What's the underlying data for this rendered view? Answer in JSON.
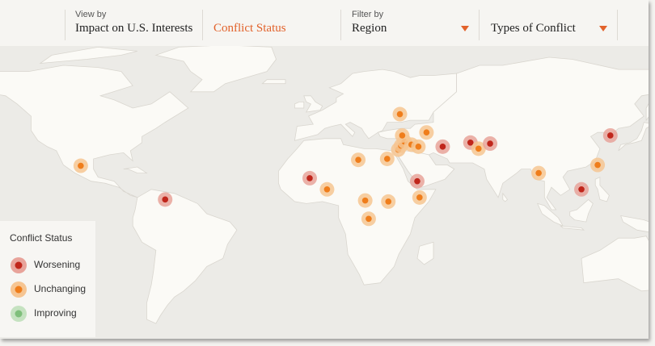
{
  "toolbar": {
    "view_by_label": "View by",
    "view_options": [
      "Impact on U.S. Interests",
      "Conflict Status"
    ],
    "active_view": "Conflict Status",
    "filter_by_label": "Filter by",
    "filters": [
      "Region",
      "Types of Conflict"
    ]
  },
  "legend": {
    "title": "Conflict Status",
    "items": [
      {
        "label": "Worsening",
        "color": "#c0261b",
        "halo": "#e8a39a"
      },
      {
        "label": "Unchanging",
        "color": "#ef7d1b",
        "halo": "#f6c592"
      },
      {
        "label": "Improving",
        "color": "#7fbf7b",
        "halo": "#c5e2c0"
      }
    ]
  },
  "colors": {
    "land": "#fbfaf6",
    "ocean": "#ecebe7",
    "border": "#d9d6cf",
    "accent": "#e2622b"
  },
  "markers": [
    {
      "status": "Unchanging",
      "lat": 23.6,
      "lon": -102.5
    },
    {
      "status": "Worsening",
      "lat": 7.0,
      "lon": -66.0
    },
    {
      "status": "Worsening",
      "lat": 17.5,
      "lon": -3.5
    },
    {
      "status": "Unchanging",
      "lat": 12.0,
      "lon": 4.0
    },
    {
      "status": "Unchanging",
      "lat": 6.5,
      "lon": 20.5
    },
    {
      "status": "Unchanging",
      "lat": -2.5,
      "lon": 22.0
    },
    {
      "status": "Unchanging",
      "lat": 6.0,
      "lon": 30.5
    },
    {
      "status": "Unchanging",
      "lat": 8.0,
      "lon": 44.0
    },
    {
      "status": "Worsening",
      "lat": 16.0,
      "lon": 43.0
    },
    {
      "status": "Unchanging",
      "lat": 26.5,
      "lon": 17.5
    },
    {
      "status": "Unchanging",
      "lat": 27.0,
      "lon": 30.0
    },
    {
      "status": "Unchanging",
      "lat": 31.5,
      "lon": 34.8
    },
    {
      "status": "Unchanging",
      "lat": 33.5,
      "lon": 36.0
    },
    {
      "status": "Unchanging",
      "lat": 35.5,
      "lon": 37.5
    },
    {
      "status": "Unchanging",
      "lat": 34.0,
      "lon": 40.5
    },
    {
      "status": "Unchanging",
      "lat": 33.0,
      "lon": 43.5
    },
    {
      "status": "Unchanging",
      "lat": 38.5,
      "lon": 36.5
    },
    {
      "status": "Unchanging",
      "lat": 40.0,
      "lon": 47.0
    },
    {
      "status": "Unchanging",
      "lat": 49.0,
      "lon": 35.5
    },
    {
      "status": "Worsening",
      "lat": 33.0,
      "lon": 54.0
    },
    {
      "status": "Worsening",
      "lat": 35.0,
      "lon": 66.0
    },
    {
      "status": "Unchanging",
      "lat": 32.0,
      "lon": 69.5
    },
    {
      "status": "Worsening",
      "lat": 34.5,
      "lon": 74.5
    },
    {
      "status": "Unchanging",
      "lat": 20.0,
      "lon": 95.5
    },
    {
      "status": "Worsening",
      "lat": 12.0,
      "lon": 114.0
    },
    {
      "status": "Unchanging",
      "lat": 24.0,
      "lon": 121.0
    },
    {
      "status": "Worsening",
      "lat": 38.5,
      "lon": 126.5
    }
  ]
}
